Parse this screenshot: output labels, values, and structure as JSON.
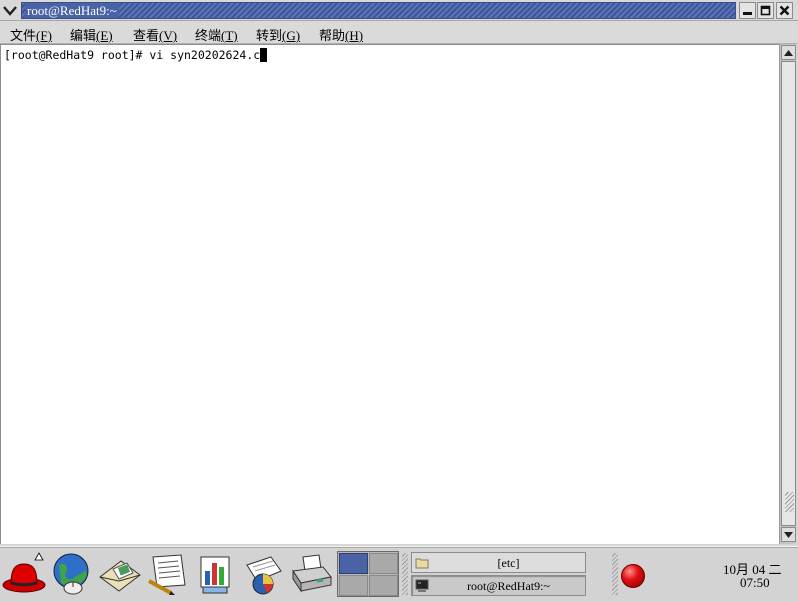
{
  "window": {
    "title": "root@RedHat9:~"
  },
  "menu": [
    {
      "label": "文件",
      "mnemonic": "(F)"
    },
    {
      "label": "编辑",
      "mnemonic": "(E)"
    },
    {
      "label": "查看",
      "mnemonic": "(V)"
    },
    {
      "label": "终端",
      "mnemonic": "(T)"
    },
    {
      "label": "转到",
      "mnemonic": "(G)"
    },
    {
      "label": "帮助",
      "mnemonic": "(H)"
    }
  ],
  "terminal": {
    "line": "[root@RedHat9 root]# vi syn20202624.c"
  },
  "launchers": [
    "redhat-menu-icon",
    "web-browser-icon",
    "email-icon",
    "writer-icon",
    "presentation-icon",
    "spreadsheet-icon",
    "printer-icon"
  ],
  "taskbar": {
    "tasks": [
      {
        "label": "[etc]",
        "icon": "folder-icon"
      },
      {
        "label": "root@RedHat9:~",
        "icon": "terminal-icon"
      }
    ]
  },
  "clock": {
    "date": "10月  04  二",
    "time": "07:50"
  },
  "colors": {
    "titlebar": "#4a62a6",
    "terminal_bg": "#ffffff",
    "panel": "#d3d3d3",
    "record": "#e01010"
  }
}
